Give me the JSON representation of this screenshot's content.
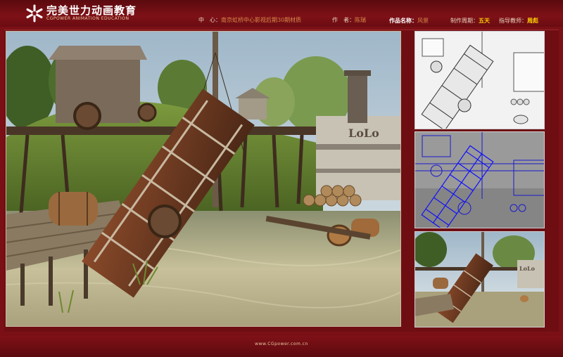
{
  "brand": {
    "name": "完美世力动画教育",
    "sub": "CGPOWER ANIMATION EDUCATION"
  },
  "meta": {
    "center_label": "中　心：",
    "center_value": "南京虹桥中心影视后期30期材质",
    "author_label": "作　者：",
    "author_value": "陈瑞",
    "work_label": "作品名称：",
    "work_value": "风景",
    "period_label": "制作周期：",
    "period_value": "五天",
    "teacher_label": "指导教师：",
    "teacher_value": "周彪"
  },
  "scene": {
    "boat_sign": "LoLo",
    "thumb_sign": "LoLo"
  },
  "footer": {
    "url": "www.CGpower.com.cn"
  }
}
